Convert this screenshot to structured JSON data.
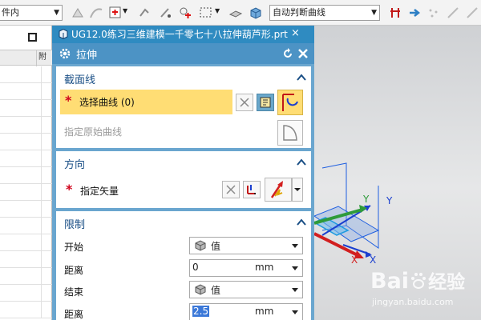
{
  "toolbar": {
    "filter_select": "件内",
    "curve_rule_select": "自动判断曲线"
  },
  "document_tab": {
    "title": "UG12.0练习三维建模一千零七十八拉伸葫芦形.prt",
    "close_glyph": "×"
  },
  "left_panel": {
    "column_label": "附"
  },
  "dialog": {
    "title": "拉伸",
    "sections": {
      "section_curve": {
        "title": "截面线",
        "select_curve": "选择曲线 (0)",
        "specify_origin_curve": "指定原始曲线",
        "required_mark": "*"
      },
      "direction": {
        "title": "方向",
        "specify_vector": "指定矢量",
        "required_mark": "*"
      },
      "limits": {
        "title": "限制",
        "rows": [
          {
            "label": "开始",
            "type": "dropdown",
            "value": "值"
          },
          {
            "label": "距离",
            "type": "number",
            "value": "0",
            "unit": "mm"
          },
          {
            "label": "结束",
            "type": "dropdown",
            "value": "值"
          },
          {
            "label": "距离",
            "type": "number",
            "value": "2.5",
            "unit": "mm",
            "selected": true
          }
        ]
      }
    }
  },
  "viewport": {
    "axis_labels": {
      "y1": "Y",
      "y2": "Y",
      "x1": "X",
      "x2": "X"
    },
    "colors": {
      "y_axis": "#2e9b3a",
      "x_axis": "#d21f1f",
      "vector": "#1b3fcf",
      "wireframe": "#1f5fe0"
    }
  },
  "watermark": {
    "logo_text": "Bai",
    "logo_suffix": "经验",
    "url": "jingyan.baidu.com"
  },
  "colors": {
    "dialog_frame": "#6aa6cf",
    "title_bar": "#4c93c5",
    "selection_highlight": "#ffdd74",
    "required": "#d0021b",
    "section_heading": "#1a4f86"
  }
}
